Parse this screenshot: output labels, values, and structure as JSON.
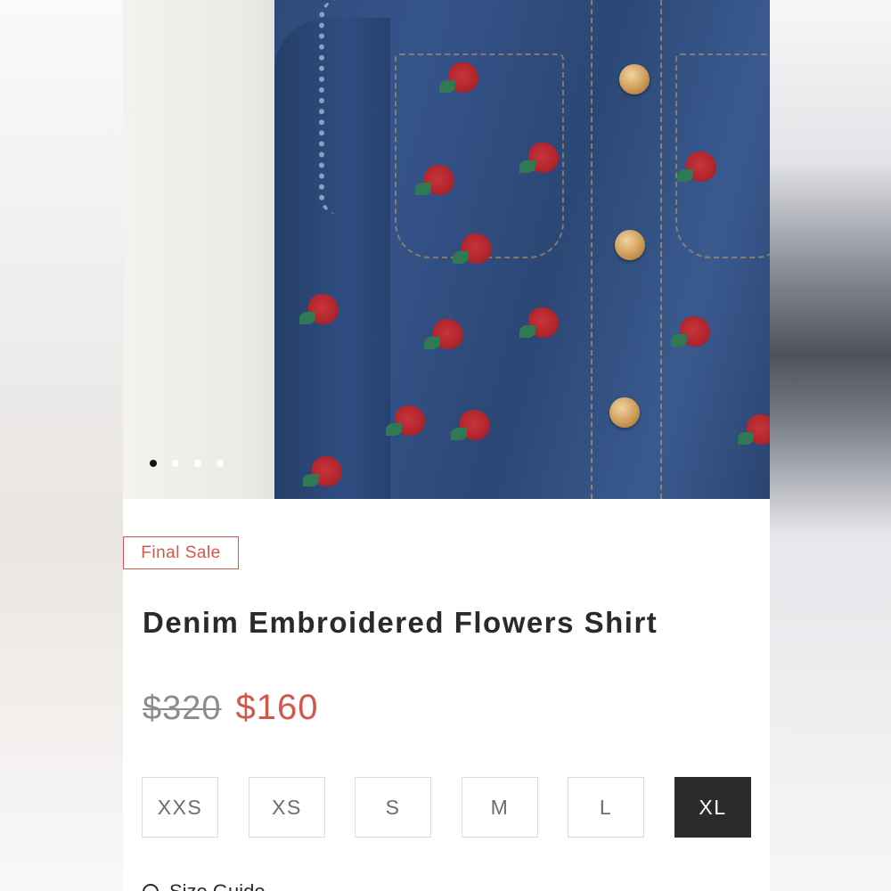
{
  "product": {
    "badge": "Final Sale",
    "title": "Denim Embroidered Flowers Shirt",
    "price_original": "$320",
    "price_sale": "$160"
  },
  "gallery": {
    "image_count": 4,
    "active_index": 0
  },
  "sizes": {
    "options": [
      "XXS",
      "XS",
      "S",
      "M",
      "L",
      "XL"
    ],
    "selected": "XL"
  },
  "size_guide": {
    "label": "Size Guide",
    "icon": "ruler-icon"
  },
  "colors": {
    "accent": "#d2574c",
    "selected_size_bg": "#2b2b2b"
  }
}
